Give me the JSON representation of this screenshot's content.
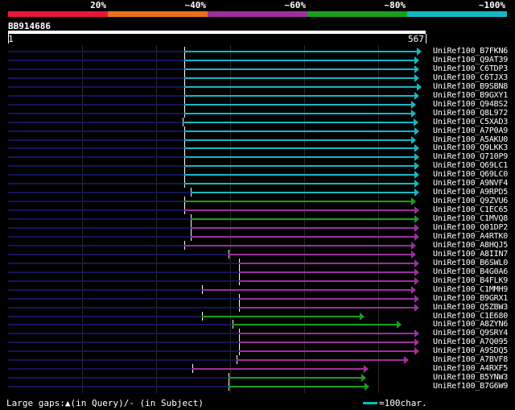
{
  "legend": {
    "segments": [
      {
        "label": "20%",
        "color": "#e8173a"
      },
      {
        "label": "~40%",
        "color": "#e8701e"
      },
      {
        "label": "~60%",
        "color": "#9c2f9c"
      },
      {
        "label": "~80%",
        "color": "#1b9e1b"
      },
      {
        "label": "~100%",
        "color": "#18b6c2"
      }
    ]
  },
  "query": {
    "name": "BB914686",
    "start": "1",
    "end": "567"
  },
  "hits": [
    {
      "label": "UniRef100_B7FKN6",
      "color": "#18b6c2",
      "start": 229,
      "end": 524
    },
    {
      "label": "UniRef100_Q9AT39",
      "color": "#18b6c2",
      "start": 229,
      "end": 521
    },
    {
      "label": "UniRef100_C6TDP3",
      "color": "#18b6c2",
      "start": 229,
      "end": 521
    },
    {
      "label": "UniRef100_C6TJX3",
      "color": "#18b6c2",
      "start": 229,
      "end": 521
    },
    {
      "label": "UniRef100_B9SBN8",
      "color": "#18b6c2",
      "start": 229,
      "end": 524
    },
    {
      "label": "UniRef100_B9GXY1",
      "color": "#18b6c2",
      "start": 229,
      "end": 521
    },
    {
      "label": "UniRef100_Q94BS2",
      "color": "#18b6c2",
      "start": 229,
      "end": 517
    },
    {
      "label": "UniRef100_Q8L972",
      "color": "#18b6c2",
      "start": 229,
      "end": 517
    },
    {
      "label": "UniRef100_C5XAD3",
      "color": "#18b6c2",
      "start": 227,
      "end": 520
    },
    {
      "label": "UniRef100_A7P0A9",
      "color": "#18b6c2",
      "start": 229,
      "end": 521
    },
    {
      "label": "UniRef100_A5AKU0",
      "color": "#18b6c2",
      "start": 229,
      "end": 517
    },
    {
      "label": "UniRef100_Q9LKK3",
      "color": "#18b6c2",
      "start": 229,
      "end": 521
    },
    {
      "label": "UniRef100_Q710P9",
      "color": "#18b6c2",
      "start": 229,
      "end": 521
    },
    {
      "label": "UniRef100_Q69LC1",
      "color": "#18b6c2",
      "start": 229,
      "end": 521
    },
    {
      "label": "UniRef100_Q69LC0",
      "color": "#18b6c2",
      "start": 229,
      "end": 521
    },
    {
      "label": "UniRef100_A9NVF4",
      "color": "#18b6c2",
      "start": 229,
      "end": 521
    },
    {
      "label": "UniRef100_A9RPD5",
      "color": "#18b6c2",
      "start": 237,
      "end": 521
    },
    {
      "label": "UniRef100_Q9ZVU6",
      "color": "#1b9e1b",
      "start": 229,
      "end": 517
    },
    {
      "label": "UniRef100_C1EC65",
      "color": "#9c2f9c",
      "start": 229,
      "end": 521
    },
    {
      "label": "UniRef100_C1MVQ8",
      "color": "#1b9e1b",
      "start": 237,
      "end": 521
    },
    {
      "label": "UniRef100_Q01DP2",
      "color": "#9c2f9c",
      "start": 237,
      "end": 521
    },
    {
      "label": "UniRef100_A4RTK0",
      "color": "#9c2f9c",
      "start": 237,
      "end": 521
    },
    {
      "label": "UniRef100_A8HQJ5",
      "color": "#9c2f9c",
      "start": 229,
      "end": 517
    },
    {
      "label": "UniRef100_A8IIN7",
      "color": "#9c2f9c",
      "start": 284,
      "end": 517
    },
    {
      "label": "UniRef100_B6SWL0",
      "color": "#9c2f9c",
      "start": 297,
      "end": 521
    },
    {
      "label": "UniRef100_B4G0A6",
      "color": "#9c2f9c",
      "start": 297,
      "end": 521
    },
    {
      "label": "UniRef100_B4FLK9",
      "color": "#9c2f9c",
      "start": 297,
      "end": 521
    },
    {
      "label": "UniRef100_C1MMH9",
      "color": "#9c2f9c",
      "start": 251,
      "end": 517
    },
    {
      "label": "UniRef100_B9GRX1",
      "color": "#9c2f9c",
      "start": 297,
      "end": 521
    },
    {
      "label": "UniRef100_Q5ZBW3",
      "color": "#9c2f9c",
      "start": 297,
      "end": 521
    },
    {
      "label": "UniRef100_C1E680",
      "color": "#1b9e1b",
      "start": 251,
      "end": 453
    },
    {
      "label": "UniRef100_A8ZYN6",
      "color": "#1b9e1b",
      "start": 289,
      "end": 499
    },
    {
      "label": "UniRef100_Q9SRY4",
      "color": "#9c2f9c",
      "start": 297,
      "end": 521
    },
    {
      "label": "UniRef100_A7Q095",
      "color": "#9c2f9c",
      "start": 297,
      "end": 521
    },
    {
      "label": "UniRef100_A9SDQ5",
      "color": "#9c2f9c",
      "start": 297,
      "end": 521
    },
    {
      "label": "UniRef100_A7BVF8",
      "color": "#9c2f9c",
      "start": 294,
      "end": 508
    },
    {
      "label": "UniRef100_A4RXF5",
      "color": "#9c2f9c",
      "start": 239,
      "end": 458
    },
    {
      "label": "UniRef100_B5YNW3",
      "color": "#1b9e1b",
      "start": 284,
      "end": 455
    },
    {
      "label": "UniRef100_B7G6W9",
      "color": "#1b9e1b",
      "start": 284,
      "end": 459
    }
  ],
  "footer": {
    "gaps_text": "Large gaps:▲(in Query)/- (in Subject)",
    "scale_text": "=100char."
  }
}
